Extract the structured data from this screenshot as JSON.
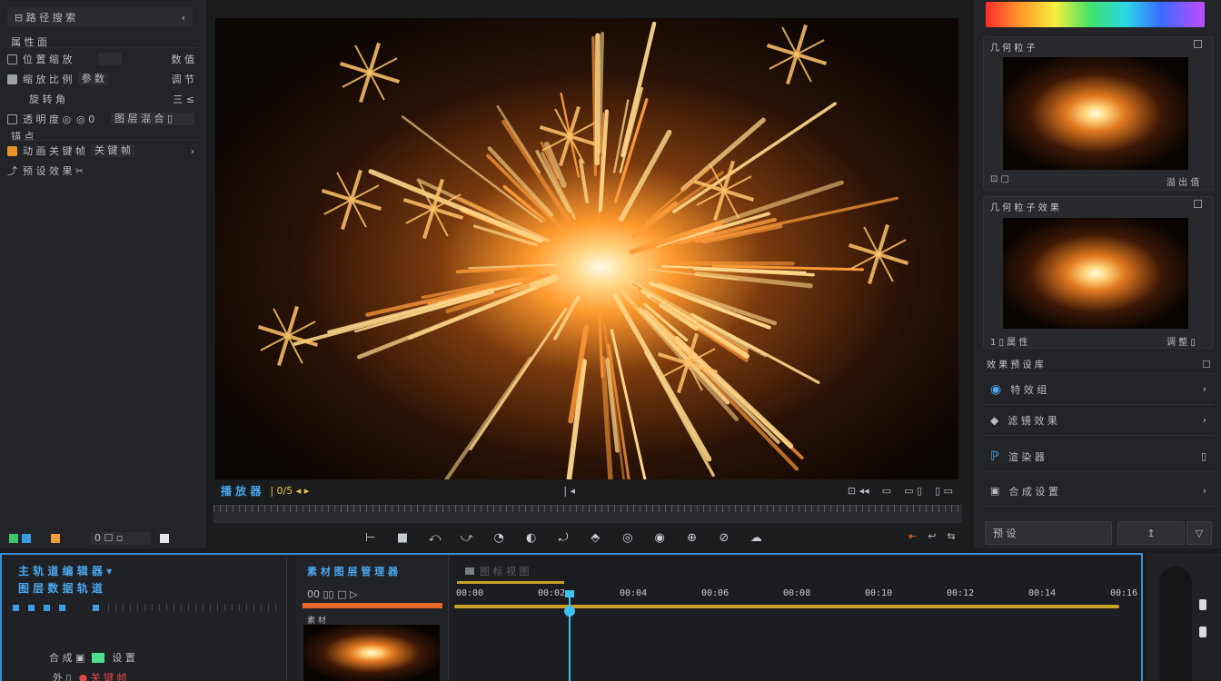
{
  "left_panel": {
    "search_label": "⊟ 路 径 搜 索",
    "section_title": "属 性 面",
    "rows": [
      {
        "label": "位 置 缩 放",
        "value": "",
        "extra": "数 值"
      },
      {
        "label": "缩 放 比 例",
        "value": "参 数",
        "extra": "调 节"
      },
      {
        "label": "旋 转 角",
        "value": "",
        "extra": "三 ≤"
      },
      {
        "label": "透 明 度 ◎",
        "value": "◎ 0",
        "extra": "图 层 混 合 ▯"
      },
      {
        "label": "锚 点",
        "value": "",
        "extra": ""
      },
      {
        "label": "动 画 关 键 帧",
        "value": "关 键 帧",
        "extra": "›"
      },
      {
        "label": "预 设 效 果 ✂",
        "value": "",
        "extra": ""
      }
    ],
    "bottom_value": "0 ☐ ▫"
  },
  "viewer": {
    "name": "播 放 器",
    "info": "| 0/5 ◂ ▸",
    "marker": "| ◂",
    "right_tools": [
      "⊡ ◂◂",
      "▭",
      "▭ ▯",
      "▯ ▭"
    ],
    "transport": [
      "⊢",
      "■",
      "⤺",
      "⤻",
      "◔",
      "◐",
      "⤾",
      "⬘",
      "◎",
      "◉",
      "⊕",
      "⊘",
      "☁"
    ],
    "bottom_right": [
      "⇤",
      "↩",
      "⇆"
    ]
  },
  "right_panel": {
    "card1_title": "几 何 粒 子",
    "card1_footer_left": "⊡ □",
    "card1_footer_right": "溢 出 值",
    "card2_title": "几 何 粒 子 效 果",
    "card2_footer_left": "1 ▯ 属 性",
    "card2_footer_right": "调 整 ▯",
    "effects_title": "效 果 预 设 库",
    "items": [
      {
        "label": "特 效 组",
        "icon": "swirl-icon"
      },
      {
        "label": "滤 镜 效 果",
        "icon": "gem-icon"
      },
      {
        "label": "渲 染 器",
        "icon": "pen-icon"
      },
      {
        "label": "合 成 设 置",
        "icon": "layer-icon"
      }
    ],
    "btn_left": "预 设",
    "btn_mid": "↥",
    "btn_right": "▽",
    "accent": "#49a8f0"
  },
  "timeline": {
    "title": "主 轨 道 编 辑 器 ▾",
    "subtitle": "图 层 数 据 轨 道",
    "layer_panel_title": "素 材 图 层 管 理 器",
    "layer_row": "00 ▯▯ □ ▷",
    "clip_label": "素 材",
    "ruler_label": "图 标 视 图",
    "timecodes": [
      "00:00",
      "00:02",
      "00:04",
      "00:06",
      "00:08",
      "00:10",
      "00:12",
      "00:14",
      "00:16"
    ],
    "track_rows": [
      {
        "label": "合 成 ▣",
        "extra": "设 置"
      },
      {
        "label": "外 ▯",
        "extra": "● 关 键 帧"
      }
    ]
  }
}
